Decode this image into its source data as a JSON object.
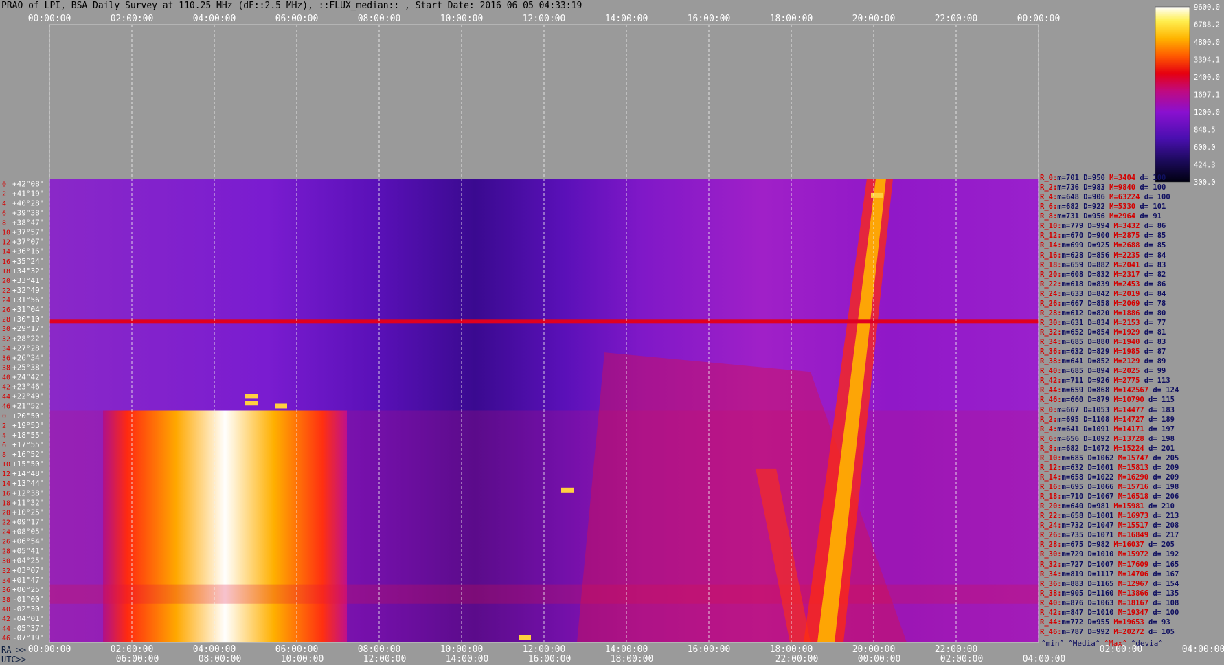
{
  "header": {
    "title": "PRAO of LPI, BSA Daily Survey at 110.25 MHz (dF::2.5 MHz), ::FLUX_median:: , Start Date: 2016 06 05 04:33:19"
  },
  "axis_labels": {
    "ra_prefix": "RA >>",
    "utc_prefix": "UTC>>"
  },
  "footer_columns": [
    "^min^",
    "^Media^",
    "^Max^",
    "^devia^"
  ],
  "colors": {
    "background": "#9a9a9a",
    "grid": "#e8e8e8",
    "label_red": "#d40000",
    "label_blue": "#101060"
  },
  "chart_data": {
    "type": "heatmap",
    "title": "PRAO of LPI, BSA Daily Survey at 110.25 MHz (dF::2.5 MHz), ::FLUX_median:: , Start Date: 2016 06 05 04:33:19",
    "top_axis_ticks": [
      "00:00:00",
      "02:00:00",
      "04:00:00",
      "06:00:00",
      "08:00:00",
      "10:00:00",
      "12:00:00",
      "14:00:00",
      "16:00:00",
      "18:00:00",
      "20:00:00",
      "22:00:00",
      "00:00:00"
    ],
    "ra_axis_ticks": [
      "00:00:00",
      "02:00:00",
      "04:00:00",
      "06:00:00",
      "08:00:00",
      "10:00:00",
      "12:00:00",
      "14:00:00",
      "16:00:00",
      "18:00:00",
      "20:00:00",
      "22:00:00",
      "02:00:00",
      "04:00:00"
    ],
    "utc_axis_ticks": [
      "06:00:00",
      "08:00:00",
      "10:00:00",
      "12:00:00",
      "14:00:00",
      "16:00:00",
      "18:00:00",
      "22:00:00",
      "00:00:00",
      "02:00:00",
      "04:00:00"
    ],
    "colorbar": {
      "ticks": [
        "9600.0",
        "6788.2",
        "4800.0",
        "3394.1",
        "2400.0",
        "1697.1",
        "1200.0",
        "848.5",
        "600.0",
        "424.3",
        "300.0"
      ],
      "scale": "log",
      "range": [
        300,
        9600
      ]
    },
    "declinations": [
      "+42°08'",
      "+41°19'",
      "+40°28'",
      "+39°38'",
      "+38°47'",
      "+37°57'",
      "+37°07'",
      "+36°16'",
      "+35°24'",
      "+34°32'",
      "+33°41'",
      "+32°49'",
      "+31°56'",
      "+31°04'",
      "+30°10'",
      "+29°17'",
      "+28°22'",
      "+27°28'",
      "+26°34'",
      "+25°38'",
      "+24°42'",
      "+23°46'",
      "+22°49'",
      "+21°52'",
      "+20°50'",
      "+19°53'",
      "+18°55'",
      "+17°55'",
      "+16°52'",
      "+15°50'",
      "+14°48'",
      "+13°44'",
      "+12°38'",
      "+11°32'",
      "+10°25'",
      "+09°17'",
      "+08°05'",
      "+06°54'",
      "+05°41'",
      "+04°25'",
      "+03°07'",
      "+01°47'",
      "+00°25'",
      "-01°00'",
      "-02°30'",
      "-04°01'",
      "-05°37'",
      "-07°19'"
    ],
    "row_indices": [
      "0",
      "2",
      "4",
      "6",
      "8",
      "10",
      "12",
      "14",
      "16",
      "18",
      "20",
      "22",
      "24",
      "26",
      "28",
      "30",
      "32",
      "34",
      "36",
      "38",
      "40",
      "42",
      "44",
      "46",
      "0",
      "2",
      "4",
      "6",
      "8",
      "10",
      "12",
      "14",
      "16",
      "18",
      "20",
      "22",
      "24",
      "26",
      "28",
      "30",
      "32",
      "34",
      "36",
      "38",
      "40",
      "42",
      "44",
      "46"
    ],
    "stats": [
      {
        "label": "R_0:",
        "min": "701",
        "median": "950",
        "max": "3404",
        "dev": "100"
      },
      {
        "label": "R_2:",
        "min": "736",
        "median": "983",
        "max": "9840",
        "dev": "100"
      },
      {
        "label": "R_4:",
        "min": "648",
        "median": "906",
        "max": "63224",
        "dev": "100"
      },
      {
        "label": "R_6:",
        "min": "682",
        "median": "922",
        "max": "5330",
        "dev": "101"
      },
      {
        "label": "R_8:",
        "min": "731",
        "median": "956",
        "max": "2964",
        "dev": "91"
      },
      {
        "label": "R_10:",
        "min": "779",
        "median": "994",
        "max": "3432",
        "dev": "86"
      },
      {
        "label": "R_12:",
        "min": "670",
        "median": "900",
        "max": "2875",
        "dev": "85"
      },
      {
        "label": "R_14:",
        "min": "699",
        "median": "925",
        "max": "2688",
        "dev": "85"
      },
      {
        "label": "R_16:",
        "min": "628",
        "median": "856",
        "max": "2235",
        "dev": "84"
      },
      {
        "label": "R_18:",
        "min": "659",
        "median": "882",
        "max": "2041",
        "dev": "83"
      },
      {
        "label": "R_20:",
        "min": "608",
        "median": "832",
        "max": "2317",
        "dev": "82"
      },
      {
        "label": "R_22:",
        "min": "618",
        "median": "839",
        "max": "2453",
        "dev": "86"
      },
      {
        "label": "R_24:",
        "min": "633",
        "median": "842",
        "max": "2019",
        "dev": "84"
      },
      {
        "label": "R_26:",
        "min": "667",
        "median": "858",
        "max": "2069",
        "dev": "78"
      },
      {
        "label": "R_28:",
        "min": "612",
        "median": "820",
        "max": "1886",
        "dev": "80"
      },
      {
        "label": "R_30:",
        "min": "631",
        "median": "834",
        "max": "2153",
        "dev": "77"
      },
      {
        "label": "R_32:",
        "min": "652",
        "median": "854",
        "max": "1929",
        "dev": "81"
      },
      {
        "label": "R_34:",
        "min": "685",
        "median": "880",
        "max": "1940",
        "dev": "83"
      },
      {
        "label": "R_36:",
        "min": "632",
        "median": "829",
        "max": "1985",
        "dev": "87"
      },
      {
        "label": "R_38:",
        "min": "641",
        "median": "852",
        "max": "2129",
        "dev": "89"
      },
      {
        "label": "R_40:",
        "min": "685",
        "median": "894",
        "max": "2025",
        "dev": "99"
      },
      {
        "label": "R_42:",
        "min": "711",
        "median": "926",
        "max": "2775",
        "dev": "113"
      },
      {
        "label": "R_44:",
        "min": "659",
        "median": "868",
        "max": "142567",
        "dev": "124"
      },
      {
        "label": "R_46:",
        "min": "660",
        "median": "879",
        "max": "10790",
        "dev": "115"
      },
      {
        "label": "R_0:",
        "min": "667",
        "median": "1053",
        "max": "14477",
        "dev": "183"
      },
      {
        "label": "R_2:",
        "min": "695",
        "median": "1108",
        "max": "14727",
        "dev": "189"
      },
      {
        "label": "R_4:",
        "min": "641",
        "median": "1091",
        "max": "14171",
        "dev": "197"
      },
      {
        "label": "R_6:",
        "min": "656",
        "median": "1092",
        "max": "13728",
        "dev": "198"
      },
      {
        "label": "R_8:",
        "min": "682",
        "median": "1072",
        "max": "15224",
        "dev": "201"
      },
      {
        "label": "R_10:",
        "min": "685",
        "median": "1062",
        "max": "15747",
        "dev": "205"
      },
      {
        "label": "R_12:",
        "min": "632",
        "median": "1001",
        "max": "15813",
        "dev": "209"
      },
      {
        "label": "R_14:",
        "min": "658",
        "median": "1022",
        "max": "16290",
        "dev": "209"
      },
      {
        "label": "R_16:",
        "min": "695",
        "median": "1066",
        "max": "15716",
        "dev": "198"
      },
      {
        "label": "R_18:",
        "min": "710",
        "median": "1067",
        "max": "16518",
        "dev": "206"
      },
      {
        "label": "R_20:",
        "min": "640",
        "median": "981",
        "max": "15981",
        "dev": "210"
      },
      {
        "label": "R_22:",
        "min": "658",
        "median": "1001",
        "max": "16973",
        "dev": "213"
      },
      {
        "label": "R_24:",
        "min": "732",
        "median": "1047",
        "max": "15517",
        "dev": "208"
      },
      {
        "label": "R_26:",
        "min": "735",
        "median": "1071",
        "max": "16849",
        "dev": "217"
      },
      {
        "label": "R_28:",
        "min": "675",
        "median": "982",
        "max": "16037",
        "dev": "205"
      },
      {
        "label": "R_30:",
        "min": "729",
        "median": "1010",
        "max": "15972",
        "dev": "192"
      },
      {
        "label": "R_32:",
        "min": "727",
        "median": "1007",
        "max": "17609",
        "dev": "165"
      },
      {
        "label": "R_34:",
        "min": "819",
        "median": "1117",
        "max": "14706",
        "dev": "167"
      },
      {
        "label": "R_36:",
        "min": "883",
        "median": "1165",
        "max": "12967",
        "dev": "154"
      },
      {
        "label": "R_38:",
        "min": "905",
        "median": "1160",
        "max": "13866",
        "dev": "135"
      },
      {
        "label": "R_40:",
        "min": "876",
        "median": "1063",
        "max": "18167",
        "dev": "108"
      },
      {
        "label": "R_42:",
        "min": "847",
        "median": "1010",
        "max": "19347",
        "dev": "100"
      },
      {
        "label": "R_44:",
        "min": "772",
        "median": "955",
        "max": "19653",
        "dev": "93"
      },
      {
        "label": "R_46:",
        "min": "787",
        "median": "992",
        "max": "20272",
        "dev": "105"
      }
    ]
  }
}
